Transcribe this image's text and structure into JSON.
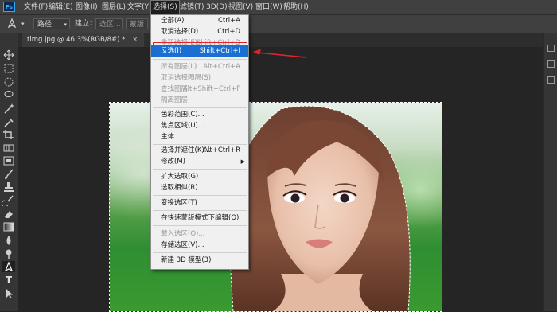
{
  "menubar": {
    "logo": "Ps",
    "items": [
      "文件(F)",
      "编辑(E)",
      "图像(I)",
      "图层(L)",
      "文字(Y)",
      "选择(S)",
      "滤镜(T)",
      "3D(D)",
      "视图(V)",
      "窗口(W)",
      "帮助(H)"
    ]
  },
  "options": {
    "path_select": "路径",
    "build_label": "建立：",
    "selection_btn": "选区...",
    "mask_btn": "蒙版"
  },
  "document_tab": {
    "title": "timg.jpg @ 46.3%(RGB/8#) *",
    "close": "×"
  },
  "select_menu": {
    "items": [
      {
        "label": "全部(A)",
        "shortcut": "Ctrl+A",
        "state": "enabled"
      },
      {
        "label": "取消选择(D)",
        "shortcut": "Ctrl+D",
        "state": "enabled"
      },
      {
        "label": "重新选择(E)",
        "shortcut": "Shift+Ctrl+D",
        "state": "disabled"
      },
      {
        "label": "反选(I)",
        "shortcut": "Shift+Ctrl+I",
        "state": "highlighted"
      },
      {
        "label": "所有图层(L)",
        "shortcut": "Alt+Ctrl+A",
        "state": "disabled"
      },
      {
        "label": "取消选择图层(S)",
        "shortcut": "",
        "state": "disabled"
      },
      {
        "label": "查找图层",
        "shortcut": "Alt+Shift+Ctrl+F",
        "state": "disabled"
      },
      {
        "label": "隔离图层",
        "shortcut": "",
        "state": "disabled"
      },
      {
        "label": "色彩范围(C)...",
        "shortcut": "",
        "state": "enabled"
      },
      {
        "label": "焦点区域(U)...",
        "shortcut": "",
        "state": "enabled"
      },
      {
        "label": "主体",
        "shortcut": "",
        "state": "enabled"
      },
      {
        "label": "选择并遮住(K)...",
        "shortcut": "Alt+Ctrl+R",
        "state": "enabled"
      },
      {
        "label": "修改(M)",
        "shortcut": "",
        "state": "enabled",
        "submenu": true
      },
      {
        "label": "扩大选取(G)",
        "shortcut": "",
        "state": "enabled"
      },
      {
        "label": "选取相似(R)",
        "shortcut": "",
        "state": "enabled"
      },
      {
        "label": "变换选区(T)",
        "shortcut": "",
        "state": "enabled"
      },
      {
        "label": "在快速蒙版模式下编辑(Q)",
        "shortcut": "",
        "state": "enabled"
      },
      {
        "label": "载入选区(O)...",
        "shortcut": "",
        "state": "disabled"
      },
      {
        "label": "存储选区(V)...",
        "shortcut": "",
        "state": "enabled"
      },
      {
        "label": "新建 3D 模型(3)",
        "shortcut": "",
        "state": "enabled"
      }
    ],
    "submenu_glyph": "▶"
  },
  "colors": {
    "highlight": "#1b6fd2",
    "annotation_red": "#e0242a"
  },
  "icons": [
    "move-icon",
    "marquee-icon",
    "ellipse-marquee-icon",
    "lasso-icon",
    "magic-wand-icon",
    "eyedropper-icon",
    "crop-icon",
    "slice-icon",
    "frame-icon",
    "brush-icon",
    "stamp-icon",
    "history-brush-icon",
    "eraser-icon",
    "gradient-icon",
    "blur-icon",
    "dodge-icon",
    "pen-icon",
    "type-icon",
    "path-select-icon"
  ]
}
